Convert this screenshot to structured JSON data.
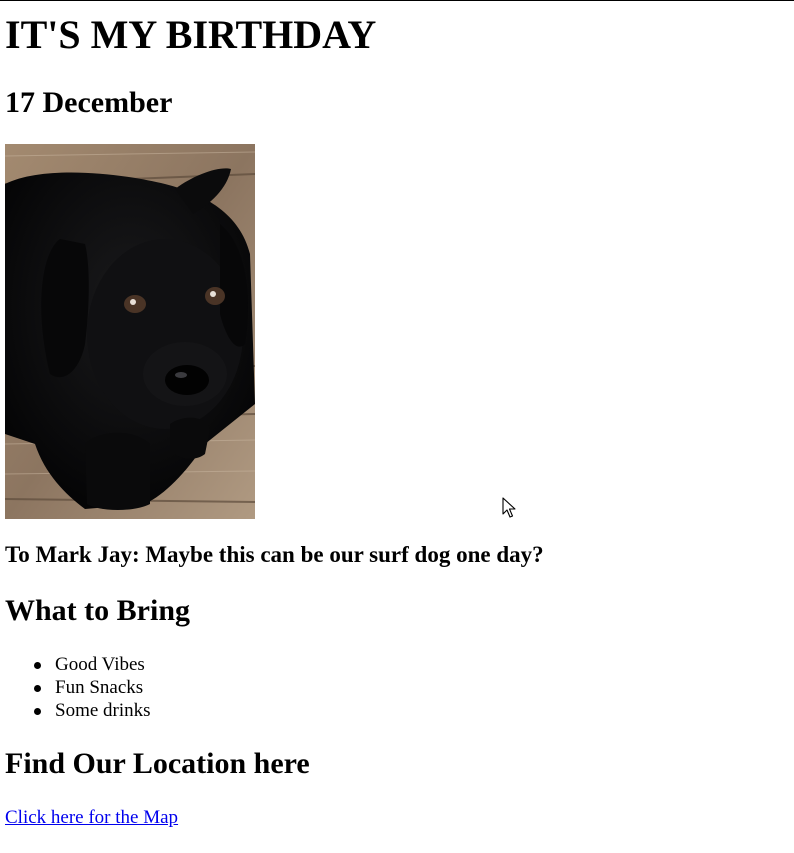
{
  "page": {
    "title": "IT'S MY BIRTHDAY",
    "date": "17 December"
  },
  "photo": {
    "icon": "black-puppy-photo"
  },
  "caption": "To Mark Jay: Maybe this can be our surf dog one day?",
  "bring": {
    "heading": "What to Bring",
    "items": [
      "Good Vibes",
      "Fun Snacks",
      "Some drinks"
    ]
  },
  "location": {
    "heading": "Find Our Location here",
    "link_label": "Click here for the Map"
  },
  "colors": {
    "link": "#0000ee",
    "text": "#000000",
    "background": "#ffffff"
  }
}
